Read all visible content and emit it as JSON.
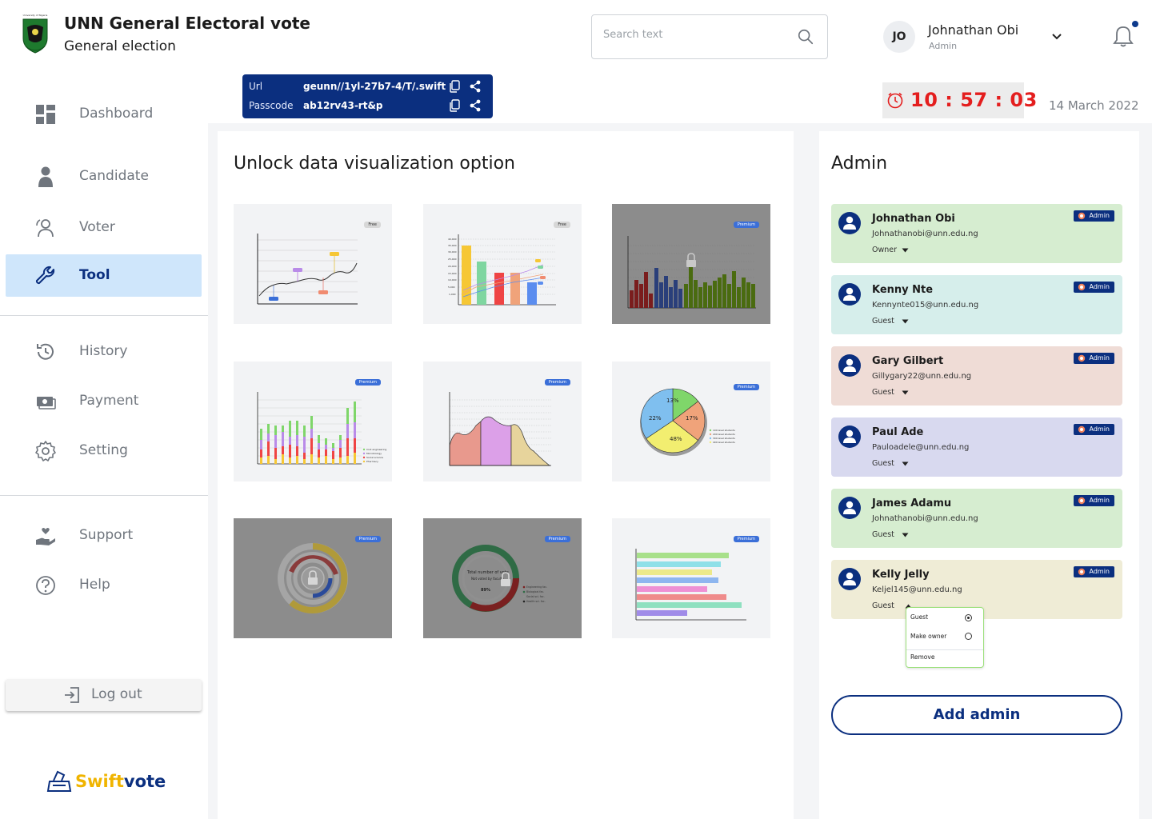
{
  "header": {
    "title": "UNN General Electoral vote",
    "subtitle": "General election",
    "logo_text": "University of Nigeria",
    "search_placeholder": "Search text",
    "user": {
      "initials": "JO",
      "name": "Johnathan Obi",
      "role": "Admin"
    },
    "notification_dot_color": "#0d3a8c"
  },
  "link_box": {
    "url_label": "Url",
    "url_value": "geunn//1yl-27b7-4/T/.swift",
    "passcode_label": "Passcode",
    "passcode_value": "ab12rv43-rt&p"
  },
  "timer": {
    "time": "10 : 57 : 03",
    "color": "#e41e1e"
  },
  "date": "14 March 2022",
  "sidebar": {
    "items": [
      {
        "label": "Dashboard",
        "icon": "dashboard-icon"
      },
      {
        "label": "Candidate",
        "icon": "person-icon"
      },
      {
        "label": "Voter",
        "icon": "users-icon"
      },
      {
        "label": "Tool",
        "icon": "wrench-icon",
        "active": true
      },
      {
        "label": "History",
        "icon": "history-icon"
      },
      {
        "label": "Payment",
        "icon": "payment-icon"
      },
      {
        "label": "Setting",
        "icon": "gear-icon"
      },
      {
        "label": "Support",
        "icon": "support-icon"
      },
      {
        "label": "Help",
        "icon": "help-icon"
      }
    ],
    "logout_label": "Log out",
    "brand": {
      "part1": "Swift",
      "part2": "vote"
    }
  },
  "main": {
    "title": "Unlock data visualization option",
    "thumbnails": [
      {
        "name": "line-chart",
        "badge": "Free",
        "locked": false
      },
      {
        "name": "bar-line-chart",
        "badge": "Free",
        "locked": false
      },
      {
        "name": "vertical-bar-chart",
        "badge": "Premium",
        "locked": true
      },
      {
        "name": "stacked-bar-chart",
        "badge": "Premium",
        "locked": false
      },
      {
        "name": "area-chart",
        "badge": "Premium",
        "locked": false
      },
      {
        "name": "pie-chart",
        "badge": "Premium",
        "locked": false
      },
      {
        "name": "radial-chart",
        "badge": "Premium",
        "locked": true
      },
      {
        "name": "donut-chart",
        "badge": "Premium",
        "locked": true
      },
      {
        "name": "horizontal-bar-chart",
        "badge": "Premium",
        "locked": false
      }
    ],
    "stacked_legend": [
      "Civil engineering",
      "Microbiology",
      "Social science",
      "Pharmacy"
    ],
    "pie_labels": [
      "13%",
      "17%",
      "22%",
      "48%"
    ],
    "pie_legend": [
      "100 level students",
      "200 level students",
      "300 level students",
      "400 level students"
    ],
    "donut_text": {
      "title": "Total number of vote",
      "subtitle": "Not voted by faculty",
      "value": "89%"
    },
    "donut_legend": [
      "Engineering fac.",
      "Biological fac.",
      "Social sci. fac.",
      "Health sci. fac."
    ],
    "bar_line_ticks": [
      "40,000",
      "35,000",
      "30,000",
      "25,000",
      "20,000",
      "15,000",
      "10,000",
      "5,000",
      "1,000"
    ]
  },
  "admin": {
    "title": "Admin",
    "tag_label": "Admin",
    "cards": [
      {
        "name": "Johnathan Obi",
        "email": "Johnathanobi@unn.edu.ng",
        "role": "Owner",
        "bg": "#d6edd0"
      },
      {
        "name": "Kenny Nte",
        "email": "Kennynte015@unn.edu.ng",
        "role": "Guest",
        "bg": "#d6eeeb"
      },
      {
        "name": "Gary Gilbert",
        "email": "Gillygary22@unn.edu.ng",
        "role": "Guest",
        "bg": "#efdcd6"
      },
      {
        "name": "Paul Ade",
        "email": "Pauloadele@unn.edu.ng",
        "role": "Guest",
        "bg": "#d8d9ef"
      },
      {
        "name": "James Adamu",
        "email": "Johnathanobi@unn.edu.ng",
        "role": "Guest",
        "bg": "#d6edd0"
      },
      {
        "name": "Kelly Jelly",
        "email": "Keljel145@unn.edu.ng",
        "role": "Guest",
        "bg": "#efecd6"
      }
    ],
    "role_menu": {
      "guest": "Guest",
      "make_owner": "Make owner",
      "remove": "Remove",
      "selected": "Guest"
    },
    "add_label": "Add admin"
  }
}
